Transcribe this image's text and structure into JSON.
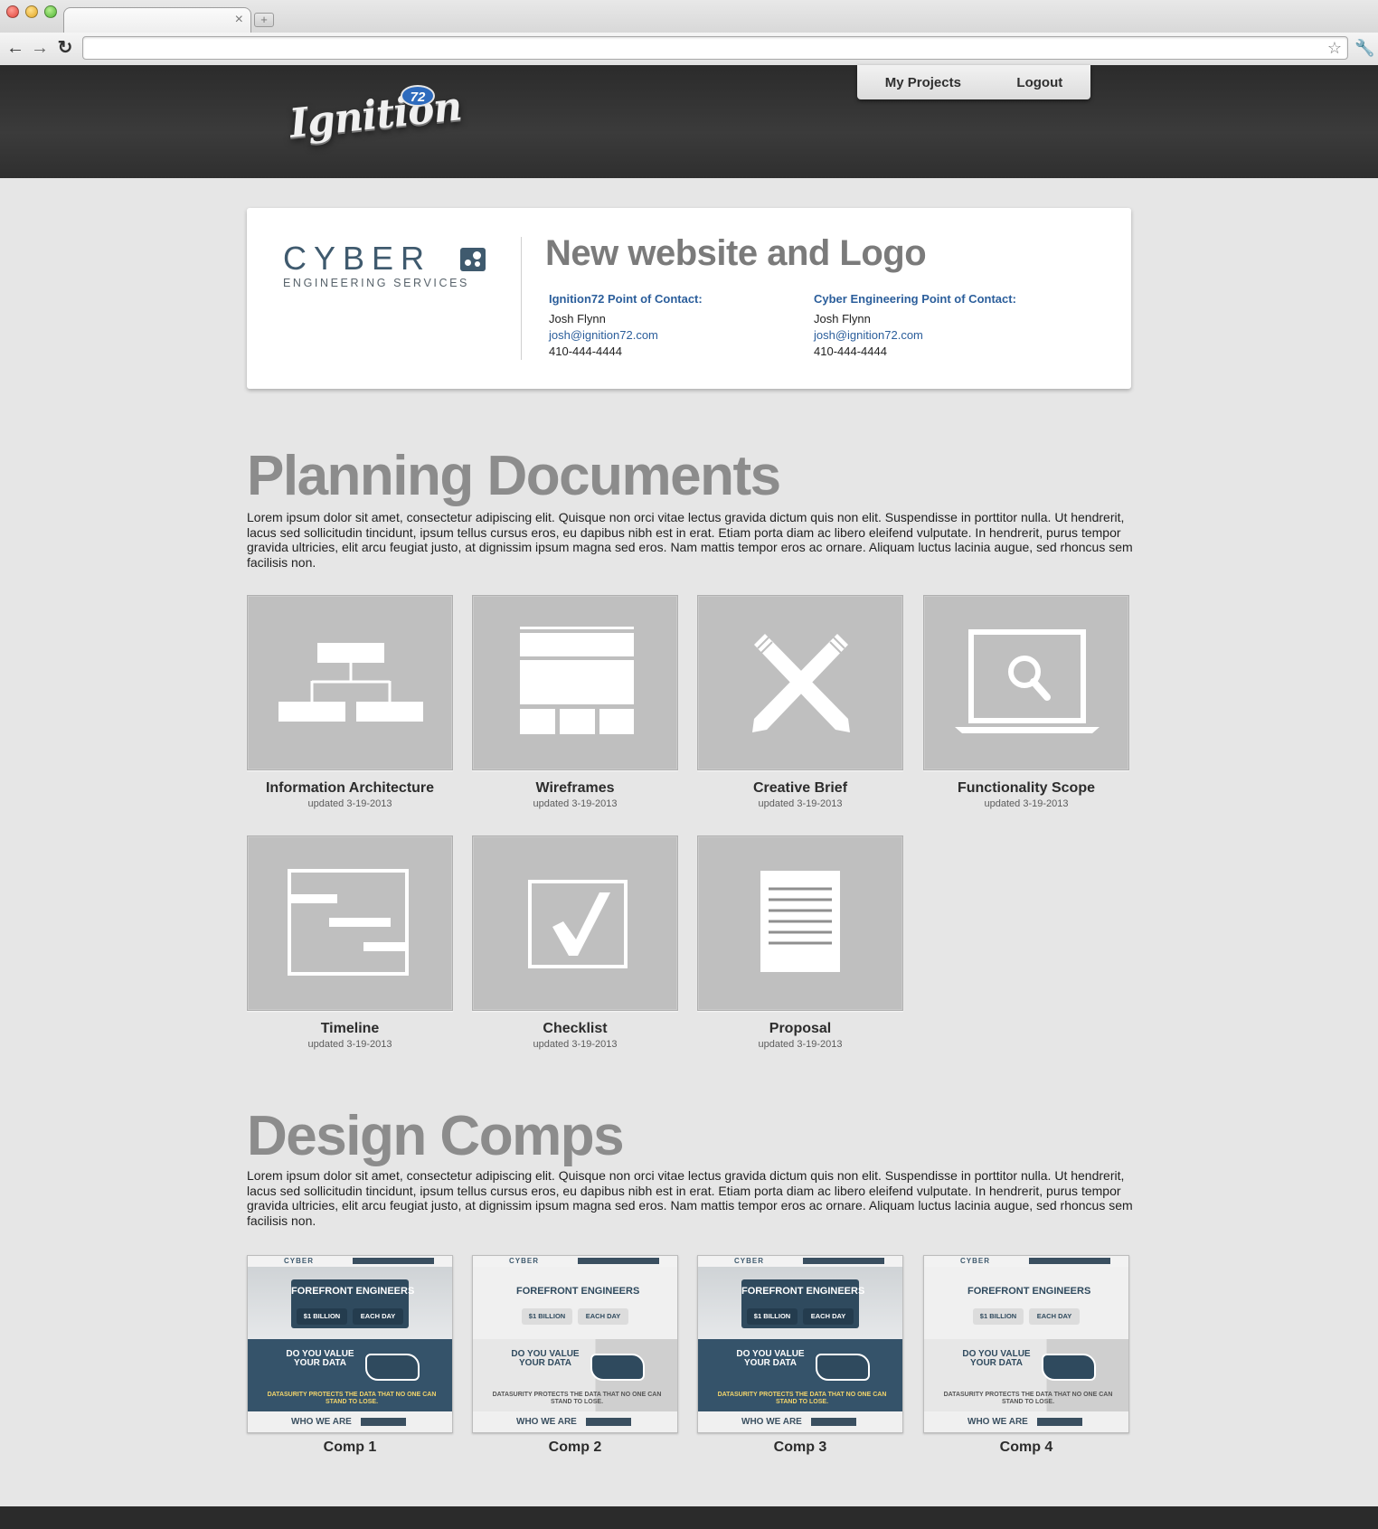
{
  "site": {
    "logo_text": "Ignition",
    "logo_badge": "72",
    "nav": [
      {
        "label": "My Projects"
      },
      {
        "label": "Logout"
      }
    ]
  },
  "project": {
    "client_logo_word": "CYBER",
    "client_logo_sub": "ENGINEERING SERVICES",
    "title": "New website and Logo",
    "contacts": [
      {
        "heading": "Ignition72 Point of Contact:",
        "name": "Josh Flynn",
        "email": "josh@ignition72.com",
        "phone": "410-444-4444"
      },
      {
        "heading": "Cyber Engineering Point of Contact:",
        "name": "Josh Flynn",
        "email": "josh@ignition72.com",
        "phone": "410-444-4444"
      }
    ]
  },
  "planning": {
    "title": "Planning Documents",
    "description": "Lorem ipsum dolor sit amet, consectetur adipiscing elit. Quisque non orci vitae lectus gravida dictum quis non elit. Suspendisse in porttitor nulla. Ut hendrerit, lacus sed sollicitudin tincidunt, ipsum tellus cursus eros, eu dapibus nibh est in erat. Etiam porta diam ac libero eleifend vulputate. In hendrerit, purus tempor gravida ultricies, elit arcu feugiat justo, at dignissim ipsum magna sed eros. Nam mattis tempor eros ac ornare. Aliquam luctus lacinia augue, sed rhoncus sem facilisis non.",
    "docs": [
      {
        "name": "Information Architecture",
        "updated": "updated 3-19-2013",
        "icon": "sitemap-icon"
      },
      {
        "name": "Wireframes",
        "updated": "updated 3-19-2013",
        "icon": "wireframe-icon"
      },
      {
        "name": "Creative Brief",
        "updated": "updated 3-19-2013",
        "icon": "crossed-pencils-icon"
      },
      {
        "name": "Functionality Scope",
        "updated": "updated 3-19-2013",
        "icon": "laptop-search-icon"
      },
      {
        "name": "Timeline",
        "updated": "updated 3-19-2013",
        "icon": "timeline-icon"
      },
      {
        "name": "Checklist",
        "updated": "updated 3-19-2013",
        "icon": "checkbox-icon"
      },
      {
        "name": "Proposal",
        "updated": "updated 3-19-2013",
        "icon": "document-icon"
      }
    ]
  },
  "design": {
    "title": "Design Comps",
    "description": "Lorem ipsum dolor sit amet, consectetur adipiscing elit. Quisque non orci vitae lectus gravida dictum quis non elit. Suspendisse in porttitor nulla. Ut hendrerit, lacus sed sollicitudin tincidunt, ipsum tellus cursus eros, eu dapibus nibh est in erat. Etiam porta diam ac libero eleifend vulputate. In hendrerit, purus tempor gravida ultricies, elit arcu feugiat justo, at dignissim ipsum magna sed eros. Nam mattis tempor eros ac ornare. Aliquam luctus lacinia augue, sed rhoncus sem facilisis non.",
    "comps": [
      {
        "name": "Comp 1",
        "variant": "dark"
      },
      {
        "name": "Comp 2",
        "variant": "light"
      },
      {
        "name": "Comp 3",
        "variant": "dark"
      },
      {
        "name": "Comp 4",
        "variant": "light"
      }
    ],
    "thumb": {
      "logo": "CYBER",
      "headline": "FOREFRONT ENGINEERS",
      "stat1": "$1 BILLION",
      "stat2": "EACH DAY",
      "question": "DO YOU VALUE YOUR DATA",
      "brand": "DATASURITY",
      "tagline": "DATASURITY PROTECTS THE DATA THAT NO ONE CAN STAND TO LOSE.",
      "who": "WHO WE ARE"
    }
  },
  "colors": {
    "accent_blue": "#2b5e9b",
    "client_slate": "#3f5a6e",
    "tile_gray": "#bfbfbf",
    "header_dark": "#2f2f2f"
  }
}
